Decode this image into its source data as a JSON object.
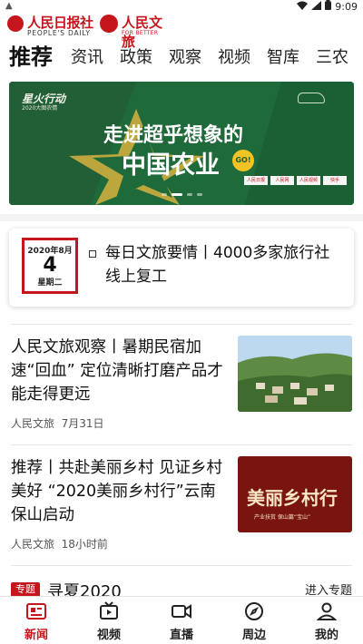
{
  "status_bar": {
    "time": "9:09",
    "left_icon": "warning-icon"
  },
  "header": {
    "logo_peoples_daily": {
      "text": "人民日报社",
      "subtitle": "PEOPLE'S DAILY"
    },
    "logo_culture": {
      "text": "人民文旅",
      "subtitle": "FOR BETTER LIFE"
    }
  },
  "tabs": [
    {
      "label": "推荐",
      "active": true
    },
    {
      "label": "资讯"
    },
    {
      "label": "政策"
    },
    {
      "label": "观察"
    },
    {
      "label": "视频"
    },
    {
      "label": "智库"
    },
    {
      "label": "三农"
    }
  ],
  "banner": {
    "campaign": "星火行动",
    "campaign_sub": "2020大图农情",
    "slogan_line1": "走进超乎想象的",
    "slogan_line2": "中国农业",
    "badge": "GO!",
    "partners": [
      "人民日报",
      "人民网",
      "人民视频",
      "快手"
    ],
    "slide_count": 4,
    "active_slide": 2
  },
  "daily": {
    "calendar": {
      "month": "2020年8月",
      "day": "4",
      "weekday": "星期二"
    },
    "title": "每日文旅要情丨4000多家旅行社线上复工"
  },
  "articles": [
    {
      "title": "人民文旅观察丨暑期民宿加速“回血” 定位清晰打磨产品才能走得更远",
      "source": "人民文旅",
      "time": "7月31日"
    },
    {
      "title": "推荐丨共赴美丽乡村 见证乡村美好 “2020美丽乡村行”云南保山启动",
      "source": "人民文旅",
      "time": "18小时前",
      "thumb_text": "美丽乡村行",
      "thumb_sub": "产业扶贫 保山篇“宝山”"
    }
  ],
  "section": {
    "tag": "专题",
    "title": "寻夏2020",
    "more": "进入专题"
  },
  "bottom_nav": [
    {
      "label": "新闻",
      "icon": "news-icon",
      "active": true
    },
    {
      "label": "视频",
      "icon": "tv-icon"
    },
    {
      "label": "直播",
      "icon": "video-camera-icon"
    },
    {
      "label": "周边",
      "icon": "compass-icon"
    },
    {
      "label": "我的",
      "icon": "user-icon"
    }
  ],
  "colors": {
    "brand_red": "#c4161c",
    "banner_green": "#1f6a3a"
  }
}
